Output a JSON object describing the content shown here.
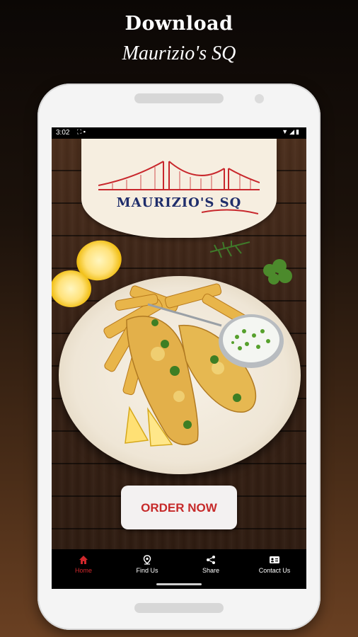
{
  "promo": {
    "title": "Download",
    "subtitle": "Maurizio's SQ"
  },
  "status_bar": {
    "time": "3:02"
  },
  "logo": {
    "text": "MAURIZIO'S SQ"
  },
  "main": {
    "order_button_label": "ORDER NOW"
  },
  "bottom_nav": {
    "items": [
      {
        "label": "Home",
        "icon": "home-icon",
        "active": true
      },
      {
        "label": "Find Us",
        "icon": "map-pin-icon",
        "active": false
      },
      {
        "label": "Share",
        "icon": "share-icon",
        "active": false
      },
      {
        "label": "Contact Us",
        "icon": "contact-card-icon",
        "active": false
      }
    ]
  },
  "colors": {
    "accent_red": "#d0282c",
    "logo_blue": "#1f2d6b"
  }
}
